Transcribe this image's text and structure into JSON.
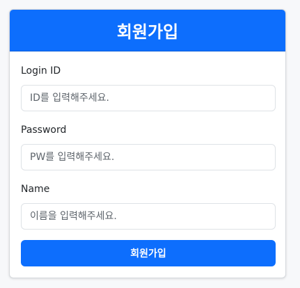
{
  "form": {
    "title": "회원가입",
    "fields": [
      {
        "label": "Login ID",
        "placeholder": "ID를 입력해주세요.",
        "value": ""
      },
      {
        "label": "Password",
        "placeholder": "PW를 입력해주세요.",
        "value": ""
      },
      {
        "label": "Name",
        "placeholder": "이름을 입력해주세요.",
        "value": ""
      }
    ],
    "submit_label": "회원가입"
  },
  "colors": {
    "primary": "#0d6efd",
    "page_background": "#f7f8fa",
    "card_background": "#ffffff",
    "input_border": "#dee2e6"
  }
}
